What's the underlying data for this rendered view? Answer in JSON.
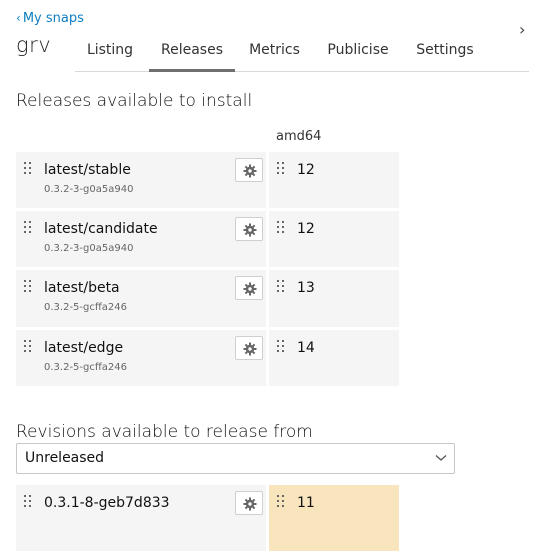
{
  "header": {
    "back_link": "My snaps",
    "back_chevron": "‹",
    "snap_name": "grv",
    "tab_scroll_icon": "chevron-right-icon",
    "tab_scroll_glyph": "›"
  },
  "tabs": [
    {
      "label": "Listing",
      "active": false
    },
    {
      "label": "Releases",
      "active": true
    },
    {
      "label": "Metrics",
      "active": false
    },
    {
      "label": "Publicise",
      "active": false
    },
    {
      "label": "Settings",
      "active": false
    }
  ],
  "releases": {
    "title": "Releases available to install",
    "architecture": "amd64",
    "channels": [
      {
        "name": "latest/stable",
        "version": "0.3.2-3-g0a5a940",
        "revision": "12"
      },
      {
        "name": "latest/candidate",
        "version": "0.3.2-3-g0a5a940",
        "revision": "12"
      },
      {
        "name": "latest/beta",
        "version": "0.3.2-5-gcffa246",
        "revision": "13"
      },
      {
        "name": "latest/edge",
        "version": "0.3.2-5-gcffa246",
        "revision": "14"
      }
    ]
  },
  "revisions": {
    "title": "Revisions available to release from",
    "filter": {
      "selected": "Unreleased",
      "icon": "chevron-down-icon"
    },
    "items": [
      {
        "version": "0.3.1-8-geb7d833",
        "revision": "11"
      }
    ]
  },
  "colors": {
    "link": "#0e7fbf",
    "card_background": "#f5f5f5",
    "highlight_background": "#f8e5bd",
    "tab_underline": "#6f6f6f"
  }
}
